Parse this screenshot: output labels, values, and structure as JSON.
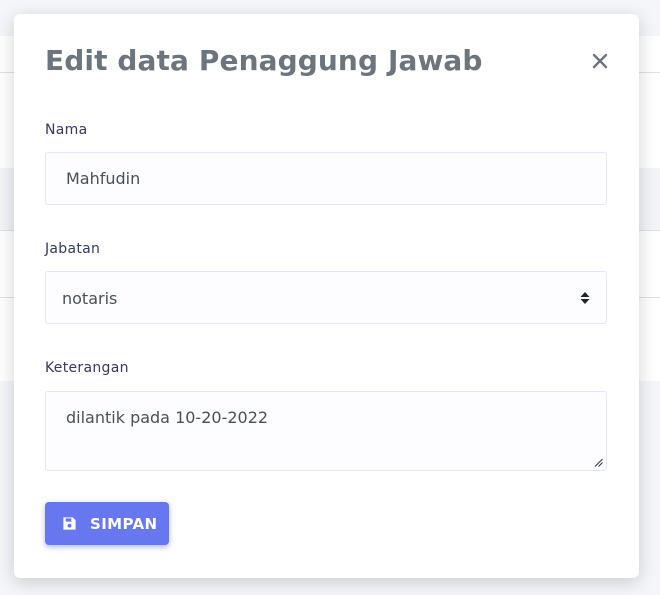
{
  "modal": {
    "title": "Edit data Penaggung Jawab"
  },
  "form": {
    "nama": {
      "label": "Nama",
      "value": "Mahfudin"
    },
    "jabatan": {
      "label": "Jabatan",
      "selected": "notaris"
    },
    "keterangan": {
      "label": "Keterangan",
      "value": "dilantik pada 10-20-2022"
    }
  },
  "actions": {
    "save_label": "SIMPAN"
  },
  "icons": {
    "close": "close-icon",
    "select": "select-arrows-icon",
    "save": "floppy-disk-icon"
  },
  "colors": {
    "primary": "#6777ef",
    "title": "#6c757d",
    "label": "#34395e",
    "input_border": "#e4e6fc",
    "input_bg": "#fdfdff"
  }
}
